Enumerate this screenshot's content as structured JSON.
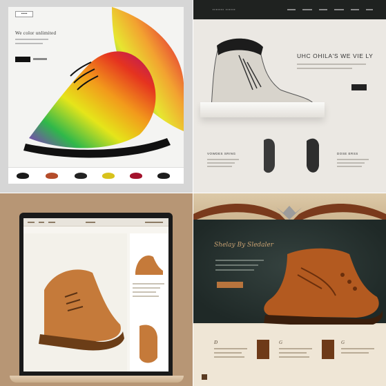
{
  "panels": {
    "rainbow": {
      "badge": "▪▪▪▪▪",
      "headline": "We color unlimited",
      "colors": {
        "accent": "#111111",
        "thumb1": "#1a1a1a",
        "thumb2": "#b44c2a",
        "thumb3": "#222222",
        "thumb4": "#d8c21c",
        "thumb5": "#a3122c",
        "thumb6": "#1c1c1c"
      }
    },
    "grey_boot": {
      "brand": "▪▪▪▪▪▪▪ ▪▪▪▪▪▪",
      "title": "UHC OHILA'S WE VIE LY",
      "label_left": "VOWDES SRING",
      "label_right": "DOSE ERSS"
    },
    "laptop": {
      "colors": {
        "leather": "#c57a3a",
        "bg": "#b79675"
      }
    },
    "brogue": {
      "script_title": "Shelay By Sledaler",
      "num_1": "Ɖ",
      "num_2": "G",
      "num_3": "G",
      "colors": {
        "leather": "#b35a20",
        "button": "#b8743d",
        "dark_bg": "#1f2927"
      }
    }
  }
}
